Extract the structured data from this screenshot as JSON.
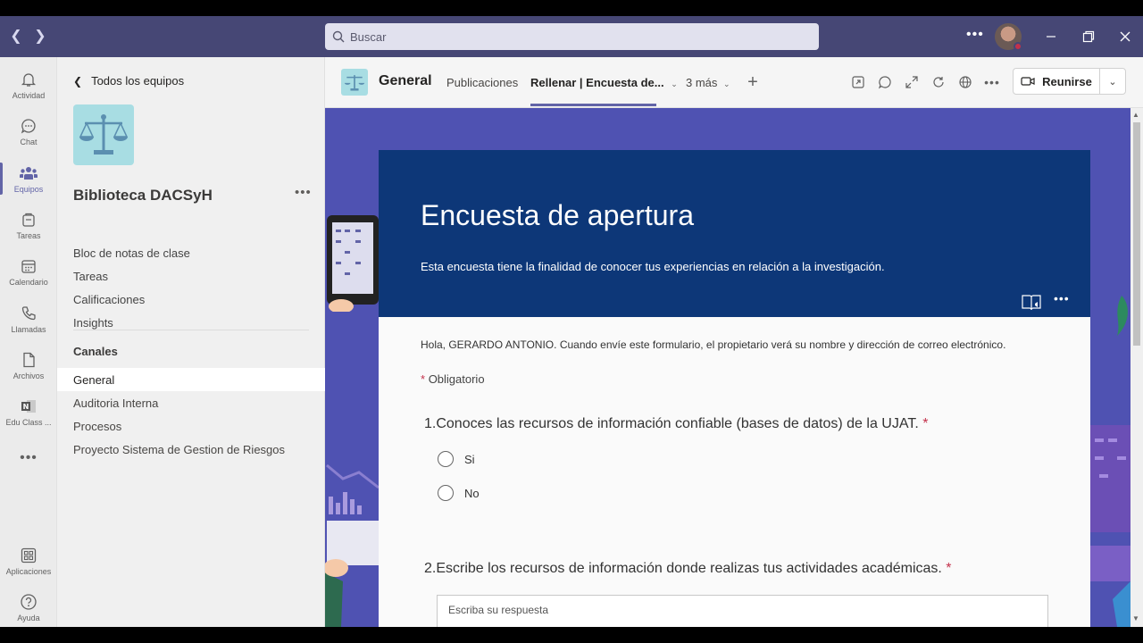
{
  "search": {
    "placeholder": "Buscar"
  },
  "rail": [
    {
      "label": "Actividad",
      "icon": "bell-icon"
    },
    {
      "label": "Chat",
      "icon": "chat-icon"
    },
    {
      "label": "Equipos",
      "icon": "teams-icon"
    },
    {
      "label": "Tareas",
      "icon": "tasks-icon"
    },
    {
      "label": "Calendario",
      "icon": "calendar-icon"
    },
    {
      "label": "Llamadas",
      "icon": "phone-icon"
    },
    {
      "label": "Archivos",
      "icon": "file-icon"
    },
    {
      "label": "Edu Class ...",
      "icon": "onenote-icon"
    },
    {
      "label": "Aplicaciones",
      "icon": "apps-icon"
    },
    {
      "label": "Ayuda",
      "icon": "help-icon"
    }
  ],
  "teampane": {
    "back_label": "Todos los equipos",
    "team_name": "Biblioteca DACSyH",
    "links": [
      "Bloc de notas de clase",
      "Tareas",
      "Calificaciones",
      "Insights"
    ],
    "channels_header": "Canales",
    "channels": [
      "General",
      "Auditoria Interna",
      "Procesos",
      "Proyecto Sistema de Gestion de Riesgos"
    ]
  },
  "header": {
    "title": "General",
    "tabs": [
      "Publicaciones",
      "Rellenar | Encuesta de...",
      "3 más"
    ],
    "meet_label": "Reunirse"
  },
  "form": {
    "title": "Encuesta de apertura",
    "subtitle": "Esta encuesta tiene la finalidad de conocer tus experiencias en relación a la investigación.",
    "notice": "Hola, GERARDO ANTONIO. Cuando envíe este formulario, el propietario verá su nombre y dirección de correo electrónico.",
    "required_label": "Obligatorio",
    "q1": {
      "number": "1.",
      "text": "Conoces las recursos de información confiable (bases de datos) de la UJAT.",
      "options": [
        "Si",
        "No"
      ]
    },
    "q2": {
      "number": "2.",
      "text": "Escribe los recursos de información donde realizas tus actividades académicas.",
      "placeholder": "Escriba su respuesta"
    }
  },
  "colors": {
    "titlebar": "#464775",
    "accent": "#6264a7",
    "banner": "#0d3778",
    "content_bg": "#4f52b2",
    "required": "#c4314b"
  }
}
